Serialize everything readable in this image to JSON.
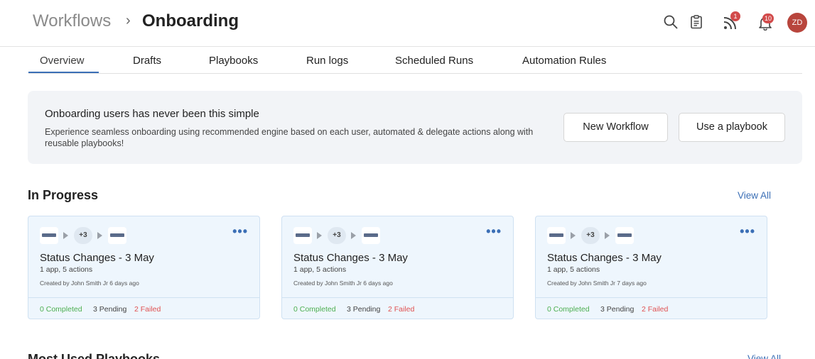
{
  "header": {
    "breadcrumb_root": "Workflows",
    "breadcrumb_sep": "›",
    "breadcrumb_current": "Onboarding",
    "feed_badge": "1",
    "notifications_badge": "10",
    "avatar_initials": "ZD"
  },
  "tabs": [
    {
      "label": "Overview",
      "active": true
    },
    {
      "label": "Drafts"
    },
    {
      "label": "Playbooks"
    },
    {
      "label": "Run logs"
    },
    {
      "label": "Scheduled Runs"
    },
    {
      "label": "Automation Rules"
    }
  ],
  "banner": {
    "title": "Onboarding users has never been this simple",
    "description": "Experience seamless onboarding using recommended engine based on each user, automated & delegate actions along with reusable playbooks!",
    "new_workflow_label": "New Workflow",
    "use_playbook_label": "Use a playbook"
  },
  "in_progress": {
    "title": "In Progress",
    "view_all": "View All",
    "cards": [
      {
        "more": "+3",
        "title": "Status Changes - 3 May",
        "subtitle": "1 app, 5 actions",
        "meta": "Created by John Smith Jr 6 days ago",
        "completed": "0 Completed",
        "pending": "3 Pending",
        "failed": "2 Failed"
      },
      {
        "more": "+3",
        "title": "Status Changes - 3 May",
        "subtitle": "1 app, 5 actions",
        "meta": "Created by John Smith Jr 6 days ago",
        "completed": "0 Completed",
        "pending": "3 Pending",
        "failed": "2 Failed"
      },
      {
        "more": "+3",
        "title": "Status Changes - 3 May",
        "subtitle": "1 app, 5 actions",
        "meta": "Created by John Smith Jr 7 days ago",
        "completed": "0 Completed",
        "pending": "3 Pending",
        "failed": "2 Failed"
      }
    ]
  },
  "most_used": {
    "title": "Most Used Playbooks",
    "view_all": "View All"
  },
  "colors": {
    "accent": "#3b6fb6",
    "success": "#4caf50",
    "danger": "#e05252",
    "avatar": "#b8453c"
  },
  "icons": [
    "search-icon",
    "clipboard-icon",
    "rss-feed-icon",
    "bell-icon",
    "more-dots-icon",
    "app-icon",
    "play-arrow-icon"
  ]
}
